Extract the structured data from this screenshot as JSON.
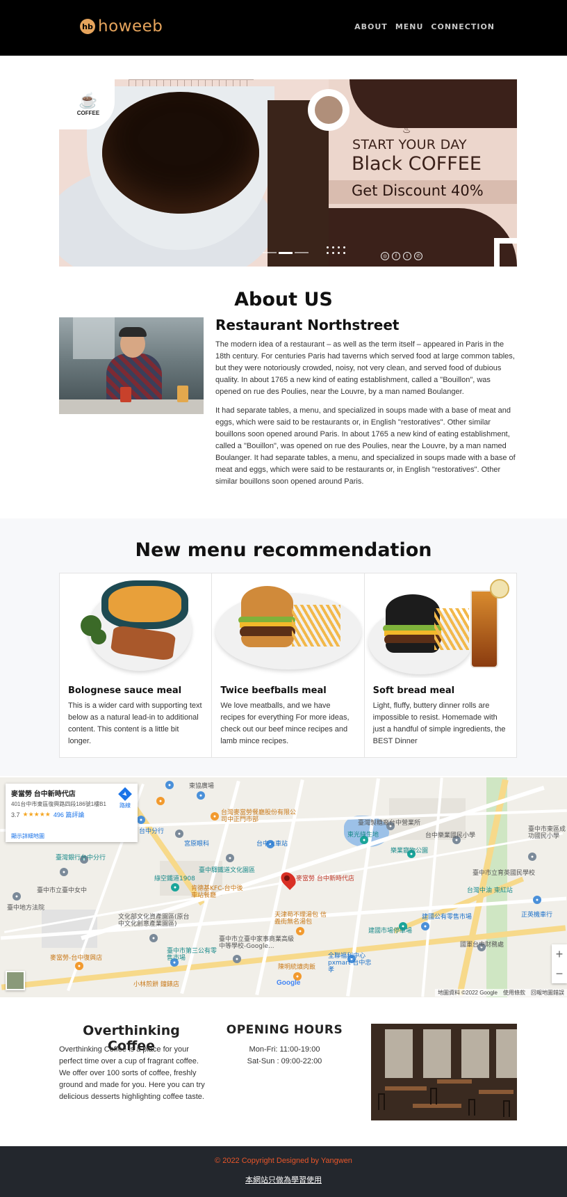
{
  "navbar": {
    "brand_mark": "hb",
    "brand_text": "howeeb",
    "links": [
      "ABOUT",
      "MENU",
      "CONNECTION"
    ]
  },
  "hero": {
    "logo_text": "COFFEE",
    "line1": "START YOUR DAY",
    "line2": "Black COFFEE",
    "line3": "Get Discount 40%",
    "social_icons": [
      "instagram-icon",
      "facebook-icon",
      "twitter-icon",
      "whatsapp-icon"
    ],
    "active_slide": 2,
    "slide_count": 3
  },
  "about": {
    "title": "About US",
    "subtitle": "Restaurant Northstreet",
    "p1": "The modern idea of a restaurant – as well as the term itself – appeared in Paris in the 18th century. For centuries Paris had taverns which served food at large common tables, but they were notoriously crowded, noisy, not very clean, and served food of dubious quality. In about 1765 a new kind of eating establishment, called a \"Bouillon\", was opened on rue des Poulies, near the Louvre, by a man named Boulanger.",
    "p2": "It had separate tables, a menu, and specialized in soups made with a base of meat and eggs, which were said to be restaurants or, in English \"restoratives\". Other similar bouillons soon opened around Paris. In about 1765 a new kind of eating establishment, called a \"Bouillon\", was opened on rue des Poulies, near the Louvre, by a man named Boulanger. It had separate tables, a menu, and specialized in soups made with a base of meat and eggs, which were said to be restaurants or, in English \"restoratives\". Other similar bouillons soon opened around Paris."
  },
  "menu": {
    "title": "New menu recommendation",
    "cards": [
      {
        "title": "Bolognese sauce meal",
        "text": "This is a wider card with supporting text below as a natural lead-in to additional content. This content is a little bit longer."
      },
      {
        "title": "Twice beefballs meal",
        "text": "We love meatballs, and we have recipes for everything For more ideas, check out our beef mince recipes and lamb mince recipes."
      },
      {
        "title": "Soft bread meal",
        "text": "Light, fluffy, buttery dinner rolls are impossible to resist. Homemade with just a handful of simple ingredients, the BEST Dinner"
      }
    ]
  },
  "map": {
    "place_name": "麥當勞 台中新時代店",
    "address": "401台中市東區復興路四段186號1樓B1",
    "rating": "3.7",
    "stars": "★★★★★",
    "reviews": "496 篇評論",
    "directions": "路線",
    "larger_map": "顯示詳細地圖",
    "pin_label": "麥當勞 台中新時代店",
    "zoom_in": "+",
    "zoom_out": "−",
    "attribution": "地圖資料 ©2022 Google　使用條款　回報地圖錯誤",
    "google": "Google",
    "labels": {
      "l1": "東協廣場",
      "l2": "台灣麥當勞餐廳股份有限公司中正門市部",
      "l3": "台中分行",
      "l4": "宮原眼科",
      "l5": "台中火車站",
      "l6": "臺灣銀行台中分行",
      "l7": "臺中市立臺中女中",
      "l8": "綠空鐵道1908",
      "l9": "臺中驛鐵道文化園區",
      "l10": "肯德基KFC-台中後車站餐廳",
      "l11": "臺中地方法院",
      "l12": "文化部文化資產園區(原台中文化創意產業園區)",
      "l13": "天津苟不理湯包 信義街無名湯包",
      "l14": "臺中市立臺中家事商業高級中等學校-Google...",
      "l15": "麥當勞-台中復興店",
      "l16": "臺中市第三公有零售市場",
      "l17": "陳明統爌肉飯",
      "l18": "全聯福利中心 pxmart 台中忠孝",
      "l19": "小林煎餅 鐘錶店",
      "l20": "台中樂業國民小學",
      "l21": "樂業寵物公園",
      "l22": "臺灣製糖廠台中營業所",
      "l23": "東光綠生地",
      "l24": "建國公有零售市場",
      "l25": "建國市場停車場",
      "l26": "國軍台中財務處",
      "l27": "台灣中油 東紅站",
      "l28": "臺中市立育英國民學校",
      "l29": "正英機車行",
      "l30": "臺中市東區成功國民小學"
    }
  },
  "info": {
    "title1": "Overthinking Coffee",
    "text": "Overthinking Coffee is a place for your perfect time over a cup of fragrant coffee. We offer over 100 sorts of coffee, freshly ground and made for you. Here you can try delicious desserts highlighting coffee taste.",
    "title2": "OPENING HOURS",
    "hours1": "Mon-Fri: 11:00-19:00",
    "hours2": "Sat-Sun : 09:00-22:00"
  },
  "footer": {
    "copyright": "© 2022 Copyright Designed by Yangwen",
    "notice": "本網站只做為學習使用"
  },
  "colors": {
    "brand": "#e6a45c",
    "footer_text": "#e8562a",
    "navbar_bg": "#000000",
    "footer_bg": "#23272d"
  }
}
